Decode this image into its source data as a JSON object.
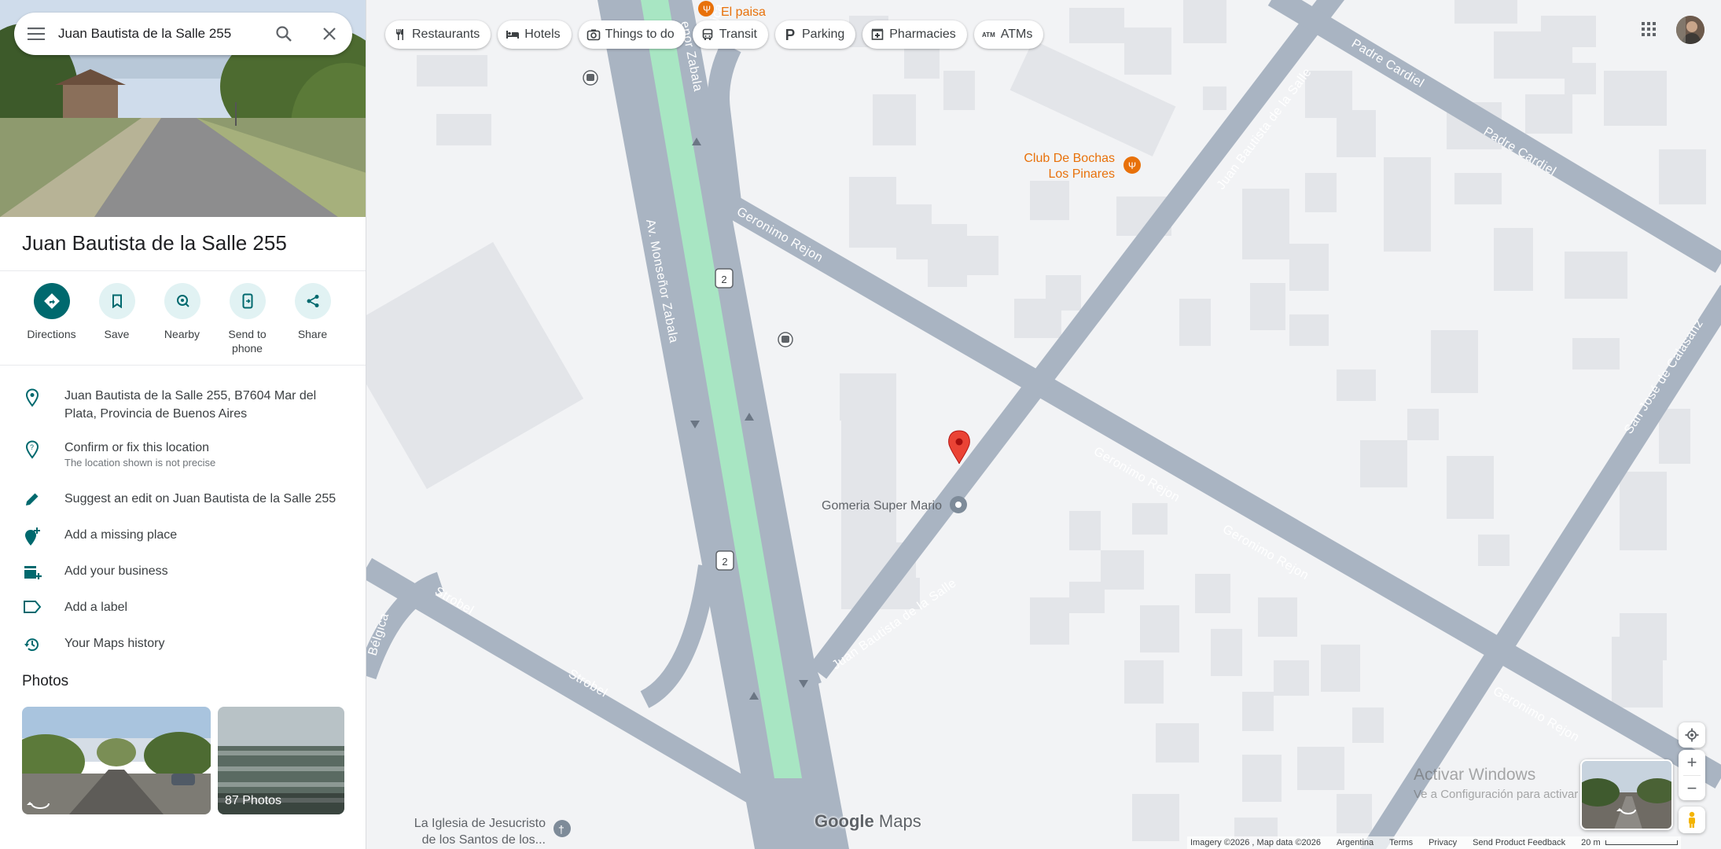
{
  "search": {
    "query": "Juan Bautista de la Salle 255"
  },
  "place": {
    "title": "Juan Bautista de la Salle 255"
  },
  "actions": [
    {
      "label": "Directions"
    },
    {
      "label": "Save"
    },
    {
      "label": "Nearby"
    },
    {
      "label": "Send to phone"
    },
    {
      "label": "Share"
    }
  ],
  "info": {
    "address": "Juan Bautista de la Salle 255, B7604 Mar del Plata, Provincia de Buenos Aires",
    "confirm": "Confirm or fix this location",
    "confirm_sub": "The location shown is not precise",
    "suggest_edit": "Suggest an edit on Juan Bautista de la Salle 255",
    "add_missing": "Add a missing place",
    "add_business": "Add your business",
    "add_label": "Add a label",
    "history": "Your Maps history"
  },
  "photos": {
    "title": "Photos",
    "count_label": "87 Photos"
  },
  "chips": [
    {
      "label": "Restaurants",
      "icon": "fork-knife-icon"
    },
    {
      "label": "Hotels",
      "icon": "bed-icon"
    },
    {
      "label": "Things to do",
      "icon": "camera-icon"
    },
    {
      "label": "Transit",
      "icon": "bus-icon"
    },
    {
      "label": "Parking",
      "icon": "parking-icon"
    },
    {
      "label": "Pharmacies",
      "icon": "pharmacy-icon"
    },
    {
      "label": "ATMs",
      "icon": "atm-icon"
    }
  ],
  "map": {
    "streets": {
      "zabala": "Av. Monseñor Zabala",
      "zabala_top": "enor Zabala",
      "belgica_top": "Bélgica",
      "belgica_left": "Bélgica",
      "geronimo_1": "Geronimo Rejon",
      "geronimo_2": "Geronimo Rejon",
      "geronimo_3": "Geronimo Rejon",
      "geronimo_4": "Geronimo Rejon",
      "salle_top": "Juan Bautista de la Salle",
      "salle_bottom": "Juan Bautista de la Salle",
      "cardiel_1": "Padre Cardiel",
      "cardiel_2": "Padre Cardiel",
      "calasanz": "San José de Calasanz",
      "strobel_1": "Strobel",
      "strobel_2": "Strobel",
      "route_shield": "2"
    },
    "pois": {
      "el_paisa": "El paisa",
      "club_bochas_1": "Club De Bochas",
      "club_bochas_2": "Los Pinares",
      "gomeria": "Gomeria Super Mario",
      "iglesia_1": "La Iglesia de Jesucristo",
      "iglesia_2": "de los Santos de los..."
    },
    "logo": {
      "google": "Google",
      "maps": "Maps"
    },
    "watermark": {
      "line1": "Activar Windows",
      "line2": "Ve a Configuración para activar Windows."
    }
  },
  "footer": {
    "imagery": "Imagery ©2026 , Map data ©2026",
    "country": "Argentina",
    "terms": "Terms",
    "privacy": "Privacy",
    "feedback": "Send Product Feedback",
    "scale": "20 m"
  },
  "colors": {
    "accent_teal": "#00696e",
    "action_bg": "#e1f2f3",
    "road": "#a9b4c2",
    "transit_green": "#a8e6c3",
    "pin_red": "#ea4335",
    "poi_orange": "#e8710a"
  }
}
